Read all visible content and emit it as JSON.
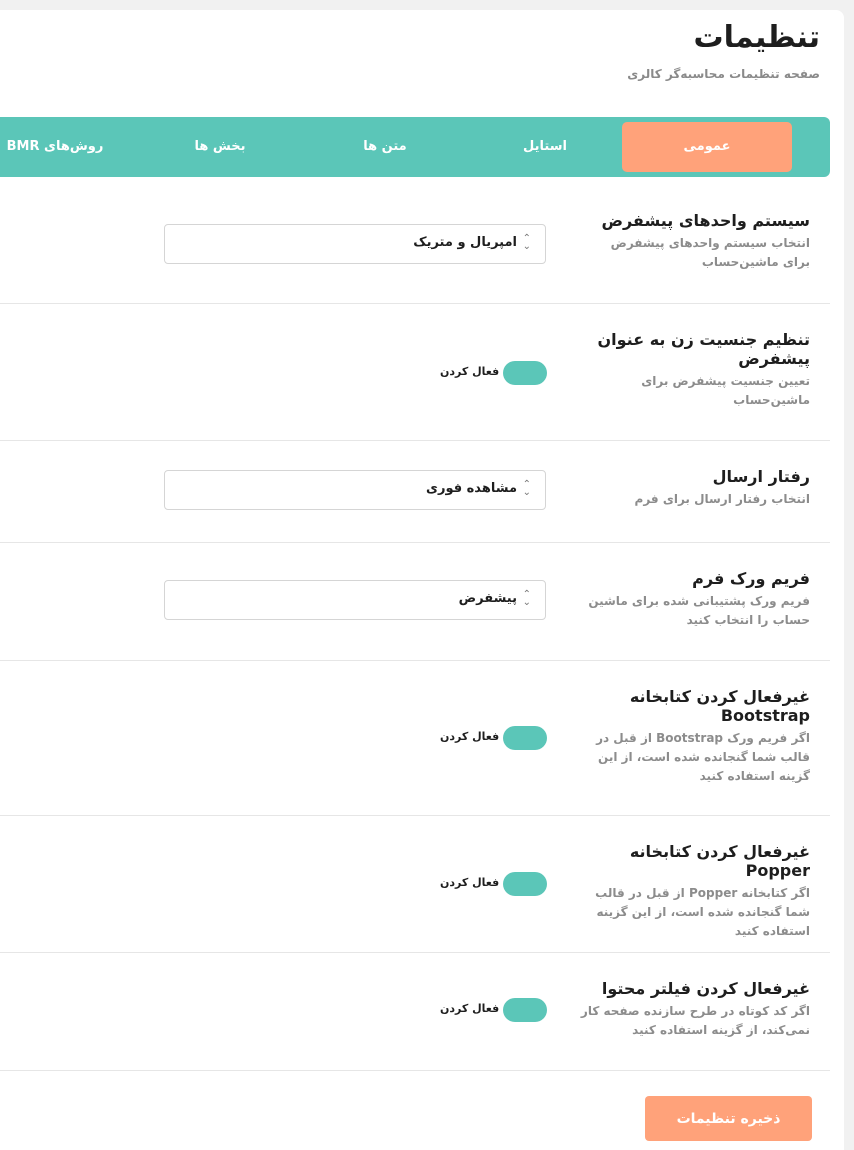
{
  "header": {
    "title": "تنظیمات",
    "subtitle": "صفحه تنظیمات محاسبه‌گر کالری"
  },
  "tabs": [
    {
      "label": "عمومی",
      "active": true
    },
    {
      "label": "استایل"
    },
    {
      "label": "متن ها"
    },
    {
      "label": "بخش ها"
    },
    {
      "label": "روش‌های BMR"
    }
  ],
  "settings": {
    "units": {
      "title": "سیستم واحدهای پیشفرض",
      "desc": "انتخاب سیستم واحدهای پیشفرض برای ماشین‌حساب",
      "value": "امپریال و متریک"
    },
    "gender": {
      "title": "تنظیم جنسیت زن به عنوان پیشفرض",
      "desc": "تعیین جنسیت پیشفرض برای ماشین‌حساب",
      "toggle_label": "فعال کردن"
    },
    "submit": {
      "title": "رفتار ارسال",
      "desc": "انتخاب رفتار ارسال برای فرم",
      "value": "مشاهده فوری"
    },
    "framework": {
      "title": "فریم ورک فرم",
      "desc": "فریم ورک پشتیبانی شده برای ماشین حساب را انتخاب کنید",
      "value": "پیشفرض"
    },
    "bootstrap": {
      "title": "غیرفعال کردن کتابخانه Bootstrap",
      "desc": "اگر فریم ورک Bootstrap از قبل در قالب شما گنجانده شده است، از این گزینه استفاده کنید",
      "toggle_label": "فعال کردن"
    },
    "popper": {
      "title": "غیرفعال کردن کتابخانه Popper",
      "desc": "اگر کتابخانه Popper از قبل در قالب شما گنجانده شده است، از این گزینه استفاده کنید",
      "toggle_label": "فعال کردن"
    },
    "content_filter": {
      "title": "غیرفعال کردن فیلتر محتوا",
      "desc": "اگر کد کوتاه در طرح سازنده صفحه کار نمی‌کند، از گزینه استفاده کنید",
      "toggle_label": "فعال کردن"
    }
  },
  "save_label": "ذخیره تنظیمات",
  "colors": {
    "accent_teal": "#5bc6b8",
    "accent_orange": "#ffa27a"
  }
}
